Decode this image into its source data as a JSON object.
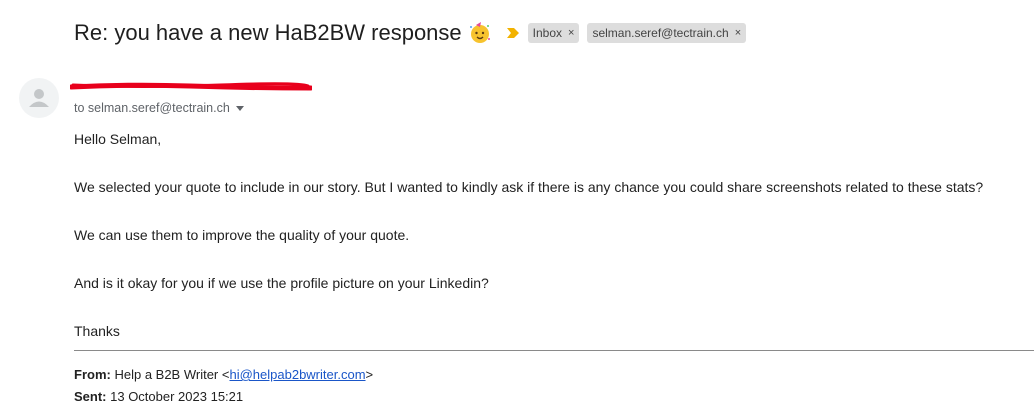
{
  "header": {
    "subject": "Re: you have a new HaB2BW response",
    "subject_emoji": "partying-face-icon",
    "labels": [
      {
        "label": "Inbox",
        "remove_symbol": "×"
      },
      {
        "label": "selman.seref@tectrain.ch",
        "remove_symbol": "×"
      }
    ]
  },
  "message": {
    "to_line": "to selman.seref@tectrain.ch",
    "greeting": "Hello Selman,",
    "paragraph_1": "We selected your quote to include in our story. But I wanted to kindly ask if there is any chance you could share screenshots related to these stats?",
    "paragraph_2": "We can use them to improve the quality of your quote.",
    "paragraph_3": "And is it okay for you if we use the profile picture on your Linkedin?",
    "closing": "Thanks"
  },
  "quoted": {
    "from_label": "From:",
    "from_name": "Help a B2B Writer <",
    "from_email": "hi@helpab2bwriter.com",
    "from_suffix": ">",
    "sent_label": "Sent:",
    "sent_value": "13 October 2023 15:21"
  },
  "colors": {
    "label_chip_bg": "#dddddd",
    "importance_marker": "#f2b200",
    "redaction": "#e8001c",
    "link": "#1a56c8"
  }
}
